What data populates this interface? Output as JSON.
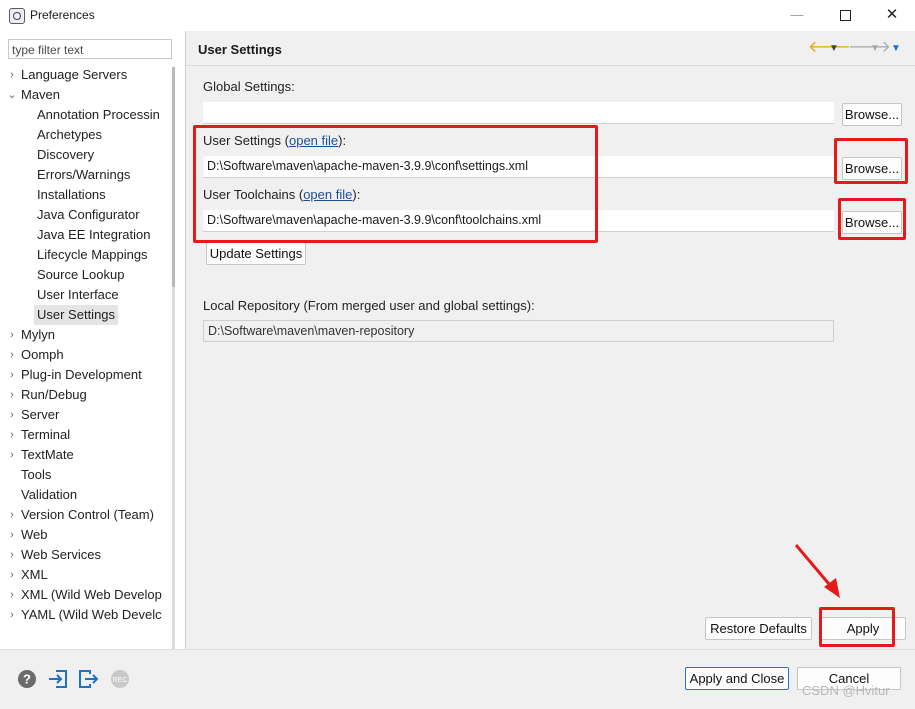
{
  "window": {
    "title": "Preferences"
  },
  "sidebar": {
    "filter_placeholder": "type filter text",
    "items": [
      {
        "label": "Language Servers",
        "expander": "›",
        "level": 0
      },
      {
        "label": "Maven",
        "expander": "⌄",
        "level": 0
      },
      {
        "label": "Annotation Processin",
        "expander": "",
        "level": 1
      },
      {
        "label": "Archetypes",
        "expander": "",
        "level": 1
      },
      {
        "label": "Discovery",
        "expander": "",
        "level": 1
      },
      {
        "label": "Errors/Warnings",
        "expander": "",
        "level": 1
      },
      {
        "label": "Installations",
        "expander": "",
        "level": 1
      },
      {
        "label": "Java Configurator",
        "expander": "",
        "level": 1
      },
      {
        "label": "Java EE Integration",
        "expander": "",
        "level": 1
      },
      {
        "label": "Lifecycle Mappings",
        "expander": "",
        "level": 1
      },
      {
        "label": "Source Lookup",
        "expander": "",
        "level": 1
      },
      {
        "label": "User Interface",
        "expander": "",
        "level": 1
      },
      {
        "label": "User Settings",
        "expander": "",
        "level": 1,
        "selected": true
      },
      {
        "label": "Mylyn",
        "expander": "›",
        "level": 0
      },
      {
        "label": "Oomph",
        "expander": "›",
        "level": 0
      },
      {
        "label": "Plug-in Development",
        "expander": "›",
        "level": 0
      },
      {
        "label": "Run/Debug",
        "expander": "›",
        "level": 0
      },
      {
        "label": "Server",
        "expander": "›",
        "level": 0
      },
      {
        "label": "Terminal",
        "expander": "›",
        "level": 0
      },
      {
        "label": "TextMate",
        "expander": "›",
        "level": 0
      },
      {
        "label": "Tools",
        "expander": "",
        "level": 0
      },
      {
        "label": "Validation",
        "expander": "",
        "level": 0
      },
      {
        "label": "Version Control (Team)",
        "expander": "›",
        "level": 0
      },
      {
        "label": "Web",
        "expander": "›",
        "level": 0
      },
      {
        "label": "Web Services",
        "expander": "›",
        "level": 0
      },
      {
        "label": "XML",
        "expander": "›",
        "level": 0
      },
      {
        "label": "XML (Wild Web Develop",
        "expander": "›",
        "level": 0
      },
      {
        "label": "YAML (Wild Web Develc",
        "expander": "›",
        "level": 0
      }
    ]
  },
  "page": {
    "title": "User Settings",
    "global_settings": {
      "label": "Global Settings:",
      "value": "",
      "browse": "Browse..."
    },
    "user_settings": {
      "label_prefix": "User Settings (",
      "link": "open file",
      "label_suffix": "):",
      "value": "D:\\Software\\maven\\apache-maven-3.9.9\\conf\\settings.xml",
      "browse": "Browse..."
    },
    "user_toolchains": {
      "label_prefix": "User Toolchains (",
      "link": "open file",
      "label_suffix": "):",
      "value": "D:\\Software\\maven\\apache-maven-3.9.9\\conf\\toolchains.xml",
      "browse": "Browse..."
    },
    "update_settings": "Update Settings",
    "local_repository": {
      "label": "Local Repository (From merged user and global settings):",
      "value": "D:\\Software\\maven\\maven-repository"
    },
    "restore_defaults": "Restore Defaults",
    "apply": "Apply"
  },
  "footer": {
    "apply_and_close": "Apply and Close",
    "cancel": "Cancel",
    "watermark": "CSDN @Hvitur"
  },
  "colors": {
    "highlight": "#e51b1b",
    "nav_back": "#e8a400",
    "link": "#1f4e97",
    "accent_blue": "#1a73c8"
  },
  "icons": [
    "eclipse-preferences-icon",
    "minimize-icon",
    "maximize-icon",
    "close-icon",
    "back-arrow-icon",
    "forward-arrow-icon",
    "view-menu-icon",
    "help-icon",
    "import-icon",
    "export-icon",
    "record-icon",
    "red-arrow-icon"
  ]
}
